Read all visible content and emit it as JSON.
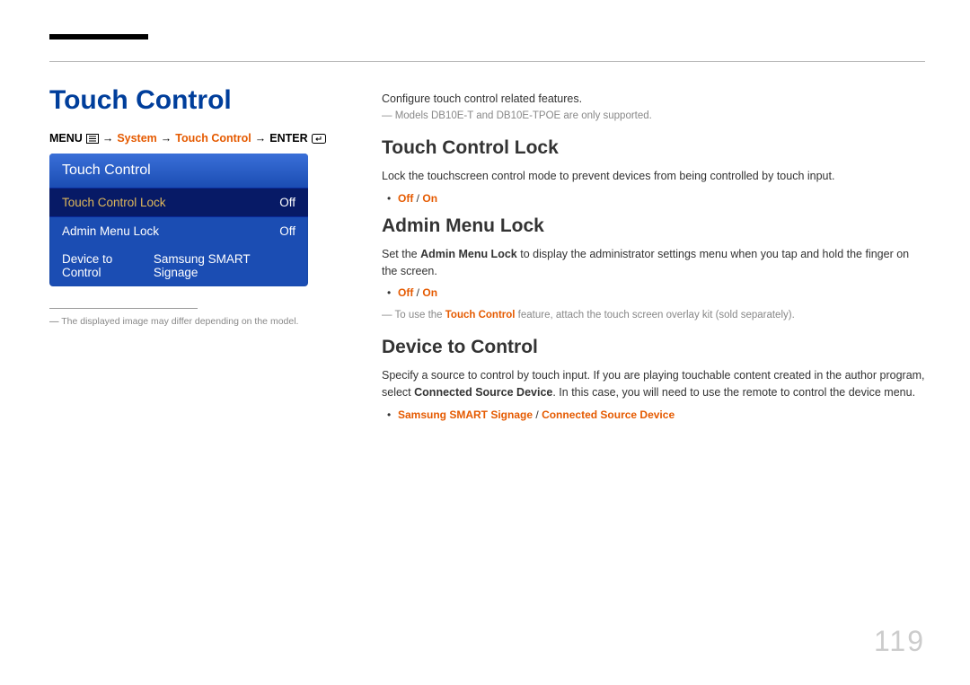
{
  "page_number": "119",
  "section_title": "Touch Control",
  "breadcrumb": {
    "menu": "MENU",
    "system": "System",
    "touch_control": "Touch Control",
    "enter": "ENTER",
    "arrow": "→"
  },
  "osd": {
    "header": "Touch Control",
    "rows": [
      {
        "label": "Touch Control Lock",
        "value": "Off",
        "selected": true
      },
      {
        "label": "Admin Menu Lock",
        "value": "Off",
        "selected": false
      },
      {
        "label": "Device to Control",
        "value": "Samsung SMART Signage",
        "selected": false
      }
    ]
  },
  "image_note": "The displayed image may differ depending on the model.",
  "intro": "Configure touch control related features.",
  "models_note": "Models DB10E-T and DB10E-TPOE are only supported.",
  "sections": {
    "tcl": {
      "heading": "Touch Control Lock",
      "desc": "Lock the touchscreen control mode to prevent devices from being controlled by touch input.",
      "opt_off": "Off",
      "opt_on": "On"
    },
    "aml": {
      "heading": "Admin Menu Lock",
      "desc_pre": "Set the ",
      "desc_bold": "Admin Menu Lock",
      "desc_post": " to display the administrator settings menu when you tap and hold the finger on the screen.",
      "opt_off": "Off",
      "opt_on": "On",
      "note_pre": "To use the ",
      "note_bold": "Touch Control",
      "note_post": " feature, attach the touch screen overlay kit (sold separately)."
    },
    "dtc": {
      "heading": "Device to Control",
      "desc_pre": "Specify a source to control by touch input. If you are playing touchable content created in the author program, select ",
      "desc_bold": "Connected Source Device",
      "desc_post": ". In this case, you will need to use the remote to control the device menu.",
      "opt1": "Samsung SMART Signage",
      "opt2": "Connected Source Device"
    }
  }
}
